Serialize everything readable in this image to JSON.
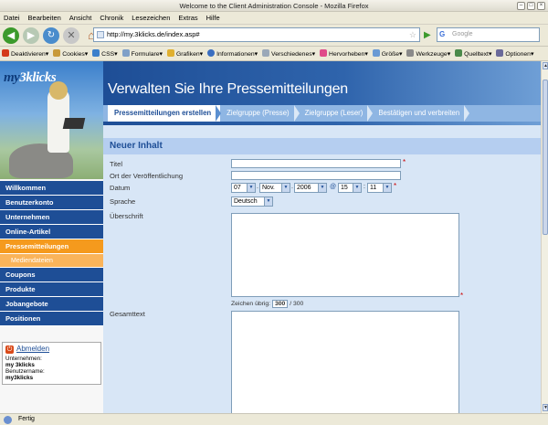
{
  "window": {
    "title": "Welcome to the Client Administration Console - Mozilla Firefox"
  },
  "menu": [
    "Datei",
    "Bearbeiten",
    "Ansicht",
    "Chronik",
    "Lesezeichen",
    "Extras",
    "Hilfe"
  ],
  "address": {
    "url": "http://my.3klicks.de/index.asp#",
    "search_placeholder": "Google"
  },
  "devtoolbar": [
    "Deaktivieren▾",
    "Cookies▾",
    "CSS▾",
    "Formulare▾",
    "Grafiken▾",
    "Informationen▾",
    "Verschiedenes▾",
    "Hervorheben▾",
    "Größe▾",
    "Werkzeuge▾",
    "Quelltext▾",
    "Optionen▾"
  ],
  "sidebar": {
    "logo_my": "my",
    "logo_name": "3klicks",
    "items": [
      {
        "label": "Willkommen"
      },
      {
        "label": "Benutzerkonto"
      },
      {
        "label": "Unternehmen"
      },
      {
        "label": "Online-Artikel"
      },
      {
        "label": "Pressemitteilungen"
      },
      {
        "label": "Mediendateien"
      },
      {
        "label": "Coupons"
      },
      {
        "label": "Produkte"
      },
      {
        "label": "Jobangebote"
      },
      {
        "label": "Positionen"
      }
    ],
    "user": {
      "logout": "Abmelden",
      "company_label": "Unternehmen:",
      "company": "my 3klicks",
      "username_label": "Benutzername:",
      "username": "my3klicks"
    }
  },
  "main": {
    "title": "Verwalten Sie Ihre Pressemitteilungen",
    "steps": [
      "Pressemitteilungen erstellen",
      "Zielgruppe (Presse)",
      "Zielgruppe (Leser)",
      "Bestätigen und verbreiten"
    ],
    "section": "Neuer Inhalt",
    "fields": {
      "titel": "Titel",
      "ort": "Ort der Veröffentlichung",
      "datum": "Datum",
      "sprache": "Sprache",
      "ueberschrift": "Überschrift",
      "gesamttext": "Gesamttext"
    },
    "date": {
      "day": "07",
      "month": "Nov.",
      "year": "2006",
      "at": "@",
      "hour": "15",
      "minute": "11"
    },
    "language": "Deutsch",
    "counter": {
      "label": "Zeichen übrig:",
      "value": "300",
      "max": "/ 300"
    },
    "required": "*"
  },
  "status": {
    "text": "Fertig"
  }
}
